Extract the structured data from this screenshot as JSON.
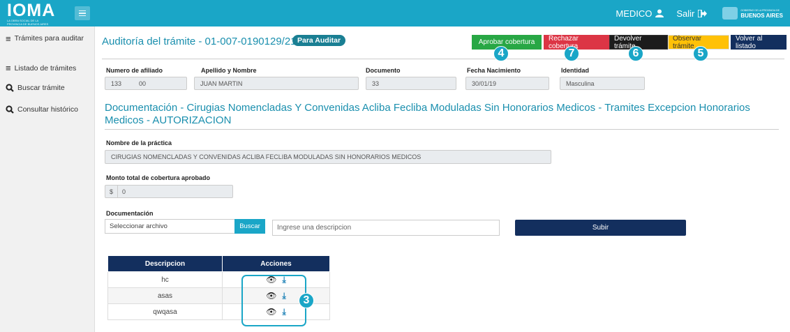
{
  "header": {
    "logo_text": "IOMA",
    "logo_subtext": "LA OBRA SOCIAL DE LA PROVINCIA DE BUENOS AIRES",
    "user_label": "MEDICO",
    "logout_label": "Salir",
    "ba_logo_small": "GOBIERNO DE LA PROVINCIA DE",
    "ba_logo_text": "BUENOS AIRES"
  },
  "sidebar": {
    "items": [
      {
        "label": "Trámites para auditar",
        "icon": "list-icon"
      },
      {
        "label": "Listado de trámites",
        "icon": "list-icon"
      },
      {
        "label": "Buscar trámite",
        "icon": "search-icon"
      },
      {
        "label": "Consultar histórico",
        "icon": "search-icon"
      }
    ]
  },
  "page": {
    "title": "Auditoría del trámite - 01-007-0190129/21",
    "status_badge": "Para Auditar"
  },
  "actions": {
    "approve": "Aprobar cobertura",
    "reject": "Rechazar cobertura",
    "return": "Devolver trámite",
    "observe": "Observar trámite",
    "back": "Volver al listado"
  },
  "colors": {
    "approve": "#28a745",
    "reject": "#dc3545",
    "return": "#1c1c1c",
    "observe": "#ffc107",
    "back": "#132f5e",
    "accent": "#1aa6c7"
  },
  "patient": {
    "affiliate_label": "Numero de afiliado",
    "affiliate_value": "133          00",
    "name_label": "Apellido y Nombre",
    "name_value": "JUAN MARTIN",
    "document_label": "Documento",
    "document_value": "33",
    "birth_label": "Fecha Nacimiento",
    "birth_value": "30/01/19",
    "identity_label": "Identidad",
    "identity_value": "Masculina"
  },
  "documentation": {
    "section_title": "Documentación - Cirugias Nomencladas Y Convenidas Acliba Fecliba Moduladas Sin Honorarios Medicos - Tramites Excepcion Honorarios Medicos - AUTORIZACION",
    "practice_label": "Nombre de la práctica",
    "practice_value": "CIRUGIAS NOMENCLADAS Y CONVENIDAS ACLIBA FECLIBA MODULADAS SIN HONORARIOS MEDICOS",
    "amount_label": "Monto total de cobertura aprobado",
    "currency": "$",
    "amount_value": "0",
    "upload_label": "Documentación",
    "file_placeholder": "Seleccionar archivo",
    "browse_button": "Buscar",
    "description_placeholder": "Ingrese una descripcion",
    "submit_button": "Subir"
  },
  "table": {
    "headers": [
      "Descripcion",
      "Acciones"
    ],
    "rows": [
      {
        "description": "hc"
      },
      {
        "description": "asas"
      },
      {
        "description": "qwqasa"
      }
    ]
  },
  "callouts": [
    "4",
    "7",
    "6",
    "5",
    "3"
  ]
}
